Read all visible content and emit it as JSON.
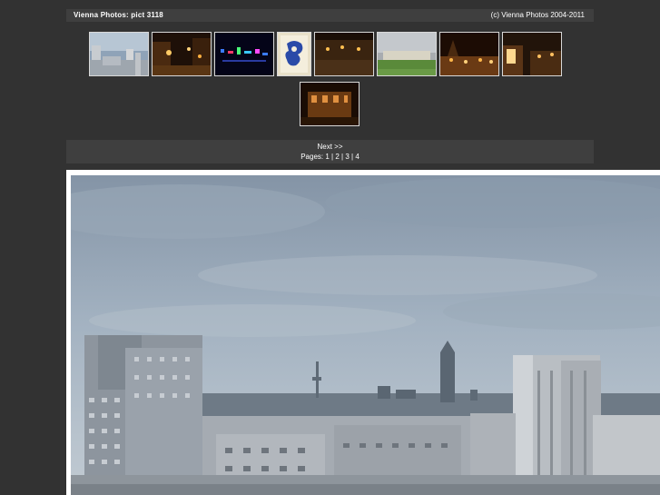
{
  "header": {
    "title": "Vienna Photos: pict 3118",
    "copyright": "(c) Vienna Photos 2004-2011"
  },
  "thumbnails": [
    {
      "id": "thumb-1",
      "scene": "cityscape-day"
    },
    {
      "id": "thumb-2",
      "scene": "night-street"
    },
    {
      "id": "thumb-3",
      "scene": "neon-night"
    },
    {
      "id": "thumb-4",
      "scene": "blue-white-sign"
    },
    {
      "id": "thumb-5",
      "scene": "night-square"
    },
    {
      "id": "thumb-6",
      "scene": "palace-lawn"
    },
    {
      "id": "thumb-7",
      "scene": "christmas-market"
    },
    {
      "id": "thumb-8",
      "scene": "market-stalls"
    },
    {
      "id": "thumb-9",
      "scene": "night-building"
    }
  ],
  "nav": {
    "next_label": "Next >>",
    "pages_label": "Pages:",
    "pages": [
      "1",
      "2",
      "3",
      "4"
    ],
    "separator": " | "
  },
  "colors": {
    "background": "#323232",
    "bar": "#3f3f3f",
    "text": "#ffffff",
    "frame": "#ffffff"
  }
}
